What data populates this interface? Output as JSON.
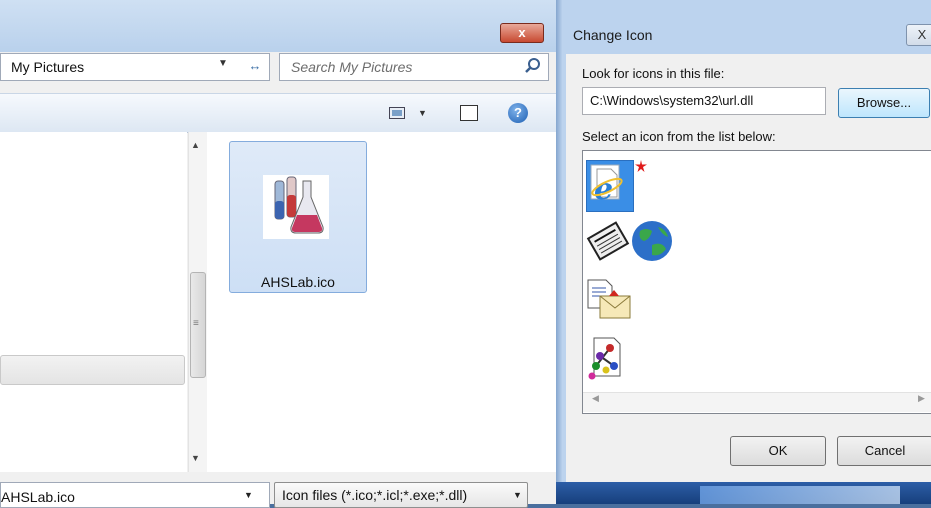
{
  "open_dialog": {
    "close_label": "x",
    "address": "My Pictures",
    "search_placeholder": "Search My Pictures",
    "file_name": "AHSLab.ico",
    "file_name_input": "AHSLab.ico",
    "file_type": "Icon files (*.ico;*.icl;*.exe;*.dll)",
    "help_label": "?"
  },
  "change_icon": {
    "title": "Change Icon",
    "close_label": "X",
    "look_label": "Look for icons in this file:",
    "path_value": "C:\\Windows\\system32\\url.dll",
    "browse_label": "Browse...",
    "select_label": "Select an icon from the list below:",
    "icons": [
      "internet-explorer-icon",
      "newspaper-globe-icon",
      "mail-document-icon",
      "molecule-document-icon"
    ],
    "ok_label": "OK",
    "cancel_label": "Cancel"
  }
}
